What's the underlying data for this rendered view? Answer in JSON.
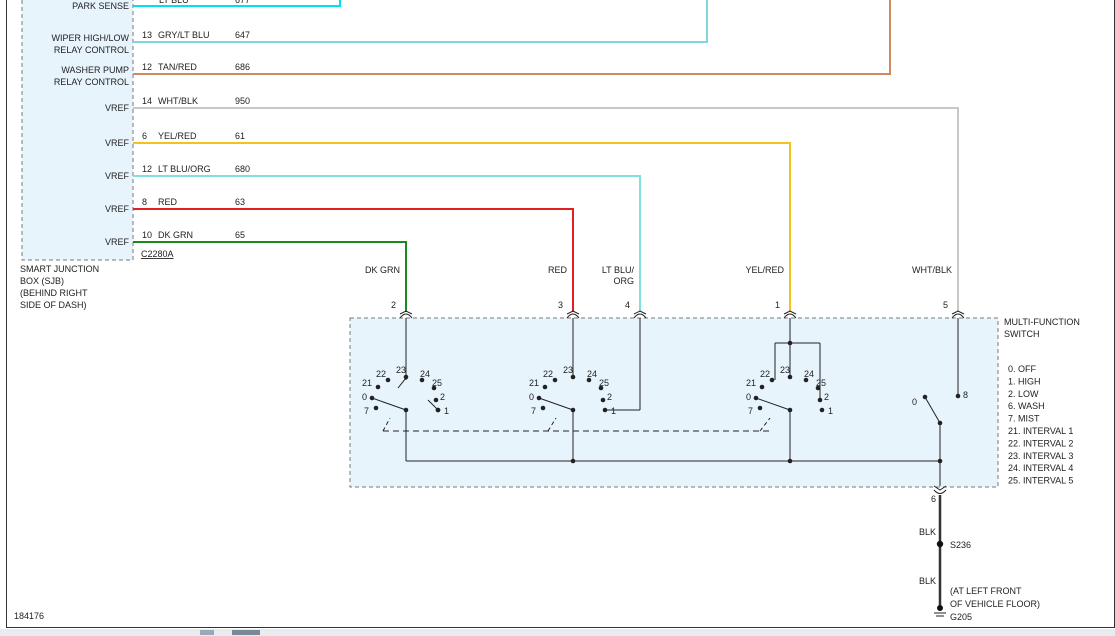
{
  "sjb": {
    "label_lines": [
      "SMART JUNCTION",
      "BOX (SJB)",
      "(BEHIND RIGHT",
      "SIDE OF DASH)"
    ],
    "connector": "C2280A"
  },
  "circuits": [
    {
      "pin_label": [
        "PARK SENSE"
      ],
      "pin": "",
      "color_name": "",
      "circuit": "",
      "color": "#00e0f0"
    },
    {
      "pin_label": [
        "WIPER HIGH/LOW",
        "RELAY CONTROL"
      ],
      "pin": "13",
      "color_name": "GRY/LT BLU",
      "circuit": "647",
      "color": "#7fd6dc"
    },
    {
      "pin_label": [
        "WASHER PUMP",
        "RELAY CONTROL"
      ],
      "pin": "12",
      "color_name": "TAN/RED",
      "circuit": "686",
      "color": "#d08860"
    },
    {
      "pin_label": [
        "VREF"
      ],
      "pin": "14",
      "color_name": "WHT/BLK",
      "circuit": "950",
      "color": "#c8c8c8"
    },
    {
      "pin_label": [
        "VREF"
      ],
      "pin": "6",
      "color_name": "YEL/RED",
      "circuit": "61",
      "color": "#f5c020"
    },
    {
      "pin_label": [
        "VREF"
      ],
      "pin": "12",
      "color_name": "LT BLU/ORG",
      "circuit": "680",
      "color": "#7fe0e0"
    },
    {
      "pin_label": [
        "VREF"
      ],
      "pin": "8",
      "color_name": "RED",
      "circuit": "63",
      "color": "#e02020"
    },
    {
      "pin_label": [
        "VREF"
      ],
      "pin": "10",
      "color_name": "DK GRN",
      "circuit": "65",
      "color": "#1a8a1a"
    }
  ],
  "switch_inputs": [
    {
      "wire_label": [
        "DK GRN"
      ],
      "pin": "2"
    },
    {
      "wire_label": [
        "RED"
      ],
      "pin": "3"
    },
    {
      "wire_label": [
        "LT BLU/",
        "ORG"
      ],
      "pin": "4"
    },
    {
      "wire_label": [
        "YEL/RED"
      ],
      "pin": "1"
    },
    {
      "wire_label": [
        "WHT/BLK"
      ],
      "pin": "5"
    }
  ],
  "mfs": {
    "title_lines": [
      "MULTI-FUNCTION",
      "SWITCH"
    ],
    "legend": [
      "0. OFF",
      "1. HIGH",
      "2. LOW",
      "6. WASH",
      "7. MIST",
      "21. INTERVAL 1",
      "22. INTERVAL 2",
      "23. INTERVAL 3",
      "24. INTERVAL 4",
      "25. INTERVAL 5"
    ],
    "output_pin": "6",
    "rotary_labels": [
      "22",
      "23",
      "24",
      "21",
      "25",
      "0",
      "2",
      "7",
      "1"
    ],
    "wash_labels": [
      "0",
      "8"
    ]
  },
  "ground": {
    "wire_top": "BLK",
    "splice": "S236",
    "wire_bottom": "BLK",
    "location_lines": [
      "(AT LEFT FRONT",
      "OF VEHICLE FLOOR)"
    ],
    "ground_id": "G205"
  },
  "figure_id": "184176"
}
